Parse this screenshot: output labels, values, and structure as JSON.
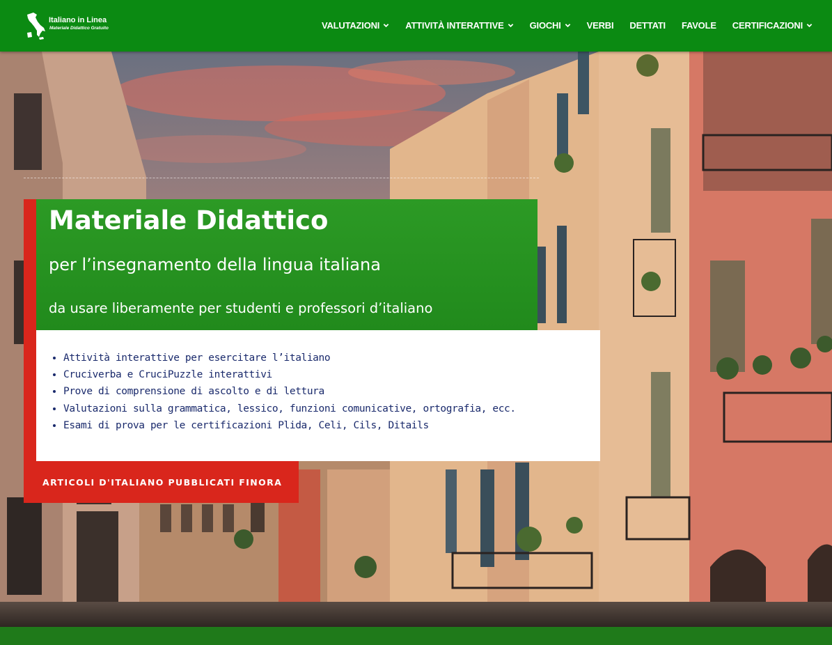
{
  "logo": {
    "title": "Italiano in Linea",
    "subtitle": "Materiale Didattico Gratuito",
    "icon": "italy-map-icon"
  },
  "nav": {
    "items": [
      {
        "label": "VALUTAZIONI",
        "dropdown": true
      },
      {
        "label": "ATTIVITÀ INTERATTIVE",
        "dropdown": true
      },
      {
        "label": "GIOCHI",
        "dropdown": true
      },
      {
        "label": "VERBI",
        "dropdown": false
      },
      {
        "label": "DETTATI",
        "dropdown": false
      },
      {
        "label": "FAVOLE",
        "dropdown": false
      },
      {
        "label": "CERTIFICAZIONI",
        "dropdown": true
      }
    ]
  },
  "hero": {
    "title": "Materiale Didattico",
    "subtitle": "per l’insegnamento della lingua italiana",
    "tagline": "da usare liberamente per studenti e professori d’italiano",
    "features": [
      "Attività interattive per esercitare l’italiano",
      "Cruciverba e CruciPuzzle interattivi",
      "Prove di comprensione di ascolto e di lettura",
      "Valutazioni sulla grammatica, lessico, funzioni comunicative, ortografia, ecc.",
      "Esami di prova per le certificazioni Plida, Celi, Cils, Ditails"
    ],
    "cta_label": "ARTICOLI D'ITALIANO PUBBLICATI FINORA"
  },
  "colors": {
    "nav_green": "#0b8a12",
    "panel_green": "#2c9a25",
    "accent_red": "#d9261c",
    "list_text": "#1a2a6c"
  }
}
